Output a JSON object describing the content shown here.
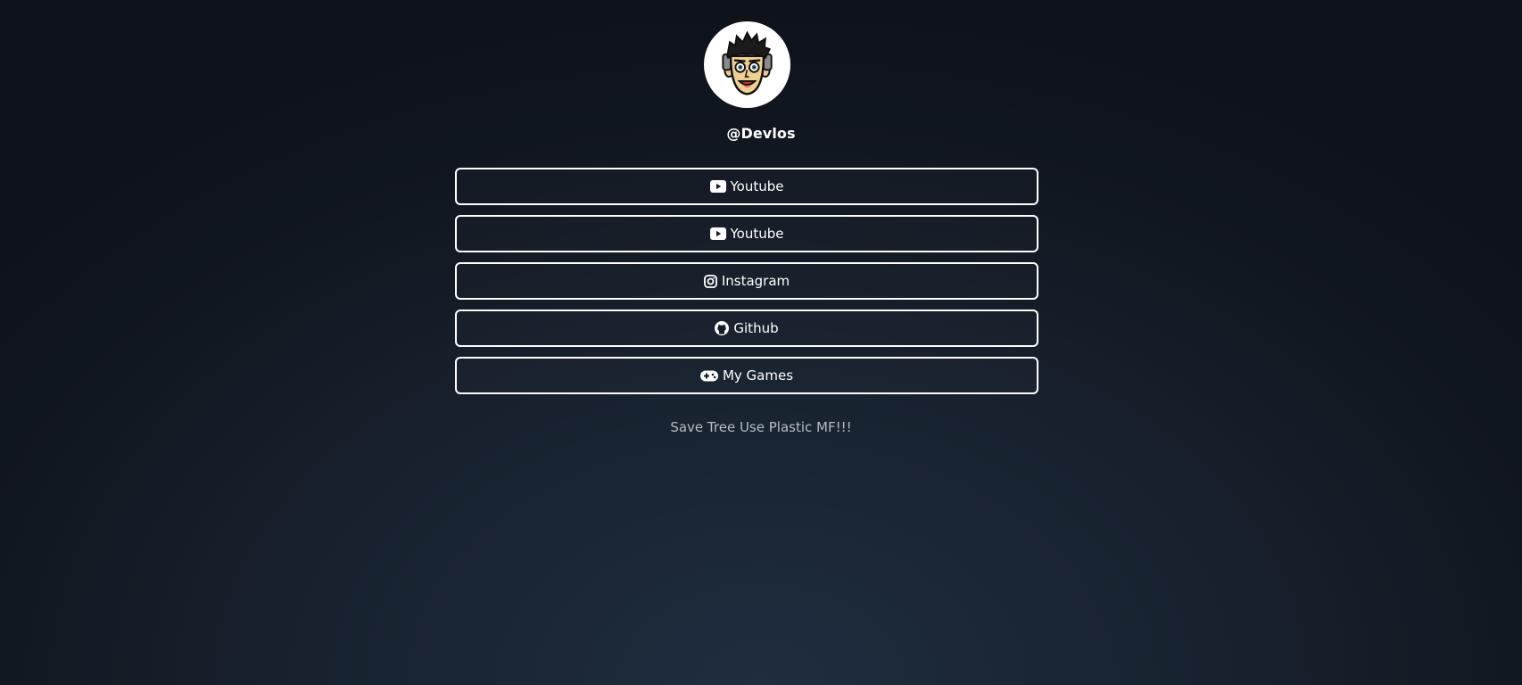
{
  "profile": {
    "username": "@Devlos",
    "avatar_icon": "cartoon-face-avatar"
  },
  "links": [
    {
      "label": "Youtube",
      "icon": "youtube-icon"
    },
    {
      "label": "Youtube",
      "icon": "youtube-icon"
    },
    {
      "label": "Instagram",
      "icon": "instagram-icon"
    },
    {
      "label": "Github",
      "icon": "github-icon"
    },
    {
      "label": "My Games",
      "icon": "gamepad-icon"
    }
  ],
  "footer": {
    "tagline": "Save Tree Use Plastic MF!!!"
  },
  "colors": {
    "background_top": "#0e131a",
    "background_bottom": "#1f2d3f",
    "button_border": "#ffffff",
    "text": "#ffffff",
    "tagline_text": "#b7bcc4"
  }
}
